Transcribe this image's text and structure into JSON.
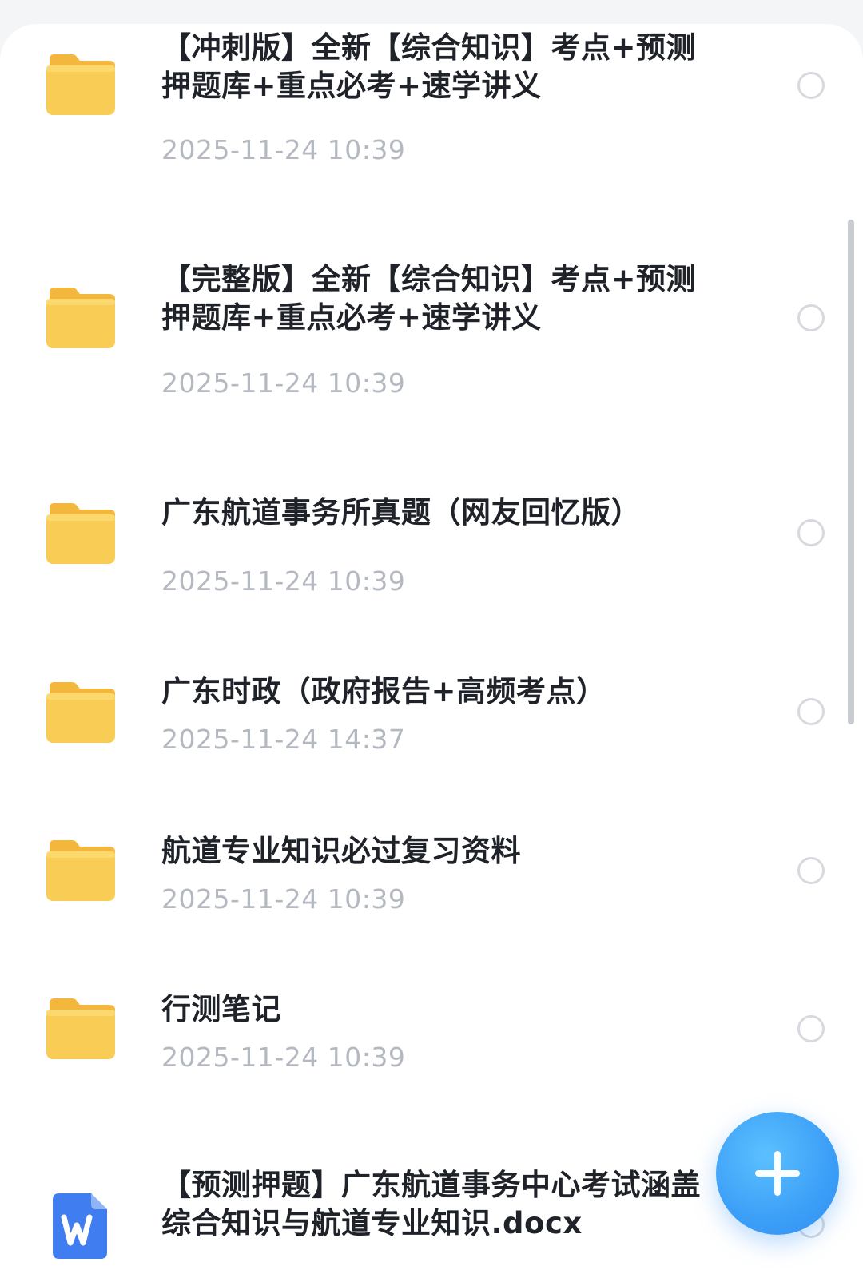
{
  "file_list": {
    "items": [
      {
        "name": "【冲刺版】全新【综合知识】考点+预测押题库+重点必考+速学讲义",
        "date": "2025-11-24 10:39",
        "type": "folder"
      },
      {
        "name": "【完整版】全新【综合知识】考点+预测押题库+重点必考+速学讲义",
        "date": "2025-11-24 10:39",
        "type": "folder"
      },
      {
        "name": "广东航道事务所真题（网友回忆版）",
        "date": "2025-11-24 10:39",
        "type": "folder"
      },
      {
        "name": "广东时政（政府报告+高频考点）",
        "date": "2025-11-24 14:37",
        "type": "folder"
      },
      {
        "name": "航道专业知识必过复习资料",
        "date": "2025-11-24 10:39",
        "type": "folder"
      },
      {
        "name": "行测笔记",
        "date": "2025-11-24 10:39",
        "type": "folder"
      },
      {
        "name": "【预测押题】广东航道事务中心考试涵盖综合知识与航道专业知识.docx",
        "type": "word-document"
      }
    ]
  },
  "fab": {
    "icon": "plus-icon",
    "color": "#3c9ff7"
  },
  "colors": {
    "folder": "#f9cd55",
    "word": "#3f7df0"
  }
}
